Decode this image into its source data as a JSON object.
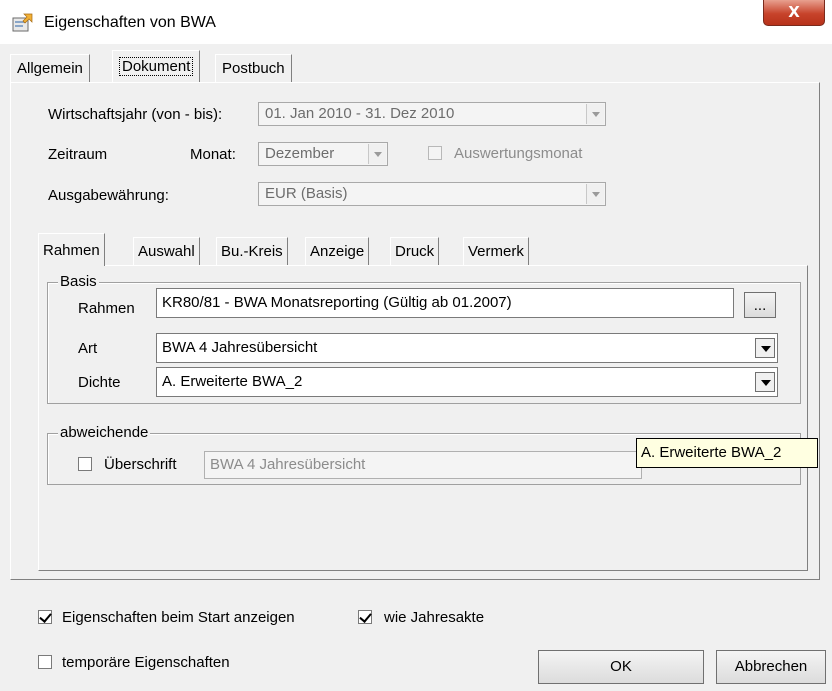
{
  "window": {
    "title": "Eigenschaften von BWA",
    "close_label": "X",
    "icon": "properties-icon"
  },
  "tabs": [
    {
      "label": "Allgemein"
    },
    {
      "label": "Dokument",
      "selected": true
    },
    {
      "label": "Postbuch"
    }
  ],
  "document": {
    "fiscal_year": {
      "label": "Wirtschaftsjahr (von - bis):",
      "value": "01. Jan 2010  -  31. Dez 2010"
    },
    "period": {
      "label": "Zeitraum",
      "month_label": "Monat:",
      "month_value": "Dezember",
      "evaluation_month_label": "Auswertungsmonat",
      "evaluation_month_checked": false
    },
    "currency": {
      "label": "Ausgabewährung:",
      "value": "EUR (Basis)"
    }
  },
  "inner_tabs": [
    {
      "label": "Rahmen",
      "selected": true
    },
    {
      "label": "Auswahl"
    },
    {
      "label": "Bu.-Kreis"
    },
    {
      "label": "Anzeige"
    },
    {
      "label": "Druck"
    },
    {
      "label": "Vermerk"
    }
  ],
  "basis": {
    "title": "Basis",
    "rahmen": {
      "label": "Rahmen",
      "value": "KR80/81 - BWA Monatsreporting (Gültig ab 01.2007)",
      "browse_label": "..."
    },
    "art": {
      "label": "Art",
      "value": "BWA 4 Jahresübersicht"
    },
    "dichte": {
      "label": "Dichte",
      "value": "A.  Erweiterte BWA_2"
    }
  },
  "abweichende": {
    "title": "abweichende",
    "ueberschrift_label": "Überschrift",
    "ueberschrift_checked": false,
    "ueberschrift_value": "BWA 4 Jahresübersicht"
  },
  "tooltip": {
    "text": "A.  Erweiterte BWA_2"
  },
  "footer": {
    "show_on_start": {
      "label": "Eigenschaften beim Start anzeigen",
      "checked": true
    },
    "like_annual": {
      "label": "wie Jahresakte",
      "checked": true
    },
    "temporary": {
      "label": "temporäre Eigenschaften",
      "checked": false
    },
    "ok_label": "OK",
    "cancel_label": "Abbrechen"
  }
}
